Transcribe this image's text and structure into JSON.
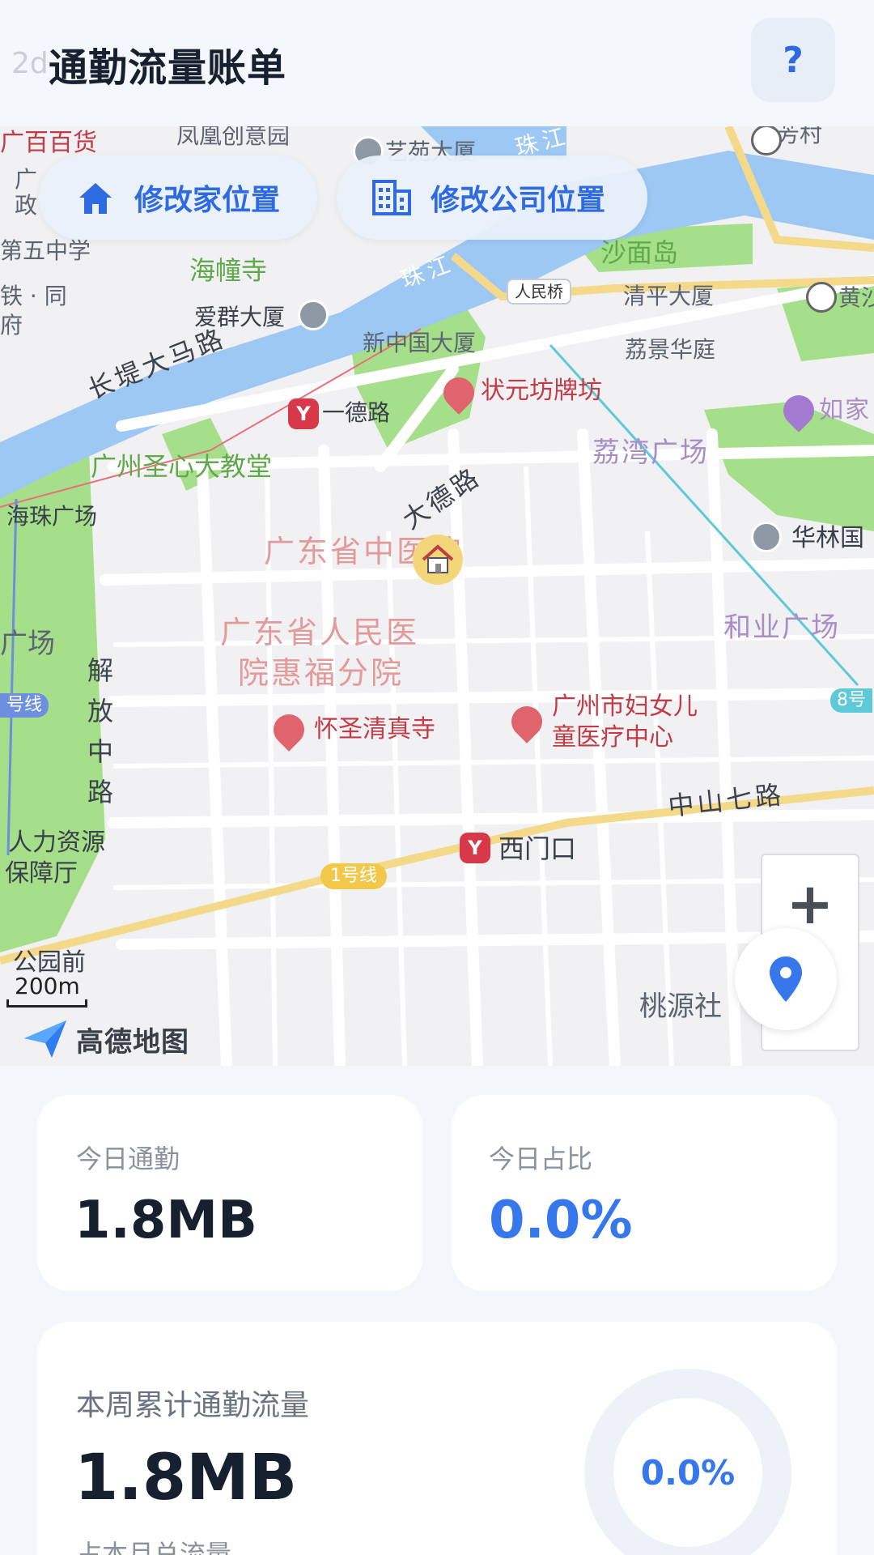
{
  "header": {
    "title": "通勤流量账单",
    "ghost_text": "2d",
    "help_label": "?"
  },
  "map": {
    "chips": {
      "home": "修改家位置",
      "company": "修改公司位置"
    },
    "labels": {
      "l1": "广百百货",
      "l2": "凤凰创意园",
      "l3": "芳村",
      "l4": "艺苑大厦",
      "l5": "第五中学",
      "l6": "海幢寺",
      "l7": "沙面岛",
      "l8": "清平大厦",
      "l9": "黄沙",
      "l10": "爱群大厦",
      "l11": "新中国大厦",
      "l12": "荔景华庭",
      "l13": "状元坊牌坊",
      "l14": "一德路",
      "l15": "长堤大马路",
      "l16": "广州圣心大教堂",
      "l17": "海珠广场",
      "l18": "大德路",
      "l19": "荔湾广场",
      "l20": "如家",
      "l21": "华林国",
      "l22": "广东省中医院",
      "l23": "广东省人民医",
      "l24": "院惠福分院",
      "l25": "和业广场",
      "l26": "广场",
      "l27": "解",
      "l28": "放",
      "l29": "中",
      "l30": "路",
      "l31": "号线",
      "l32": "怀圣清真寺",
      "l33": "广州市妇女儿",
      "l34": "童医疗中心",
      "l35": "8号",
      "l36": "中山七路",
      "l37": "西门口",
      "l38": "人力资源",
      "l39": "保障厅",
      "l40": "公园前",
      "l41": "桃源社",
      "l42": "人民桥",
      "l43": "珠江",
      "l44": "珠江",
      "l45": "1号线",
      "l46": "广",
      "l47": "政",
      "l48": "府",
      "l49": "铁 · 同"
    },
    "scale": "200m",
    "brand": "高德地图",
    "zoom_in": "+"
  },
  "stats": {
    "today_label": "今日通勤",
    "today_value": "1.8MB",
    "ratio_label": "今日占比",
    "ratio_value": "0.0%",
    "week_label": "本周累计通勤流量",
    "week_value": "1.8MB",
    "week_sub": "占本月总流量",
    "ring_value": "0.0%",
    "ring_fraction": 0.0
  },
  "colors": {
    "accent": "#3678ec",
    "water": "#9cc8f3",
    "park": "#a6df8a",
    "road_major": "#f5d98a"
  }
}
